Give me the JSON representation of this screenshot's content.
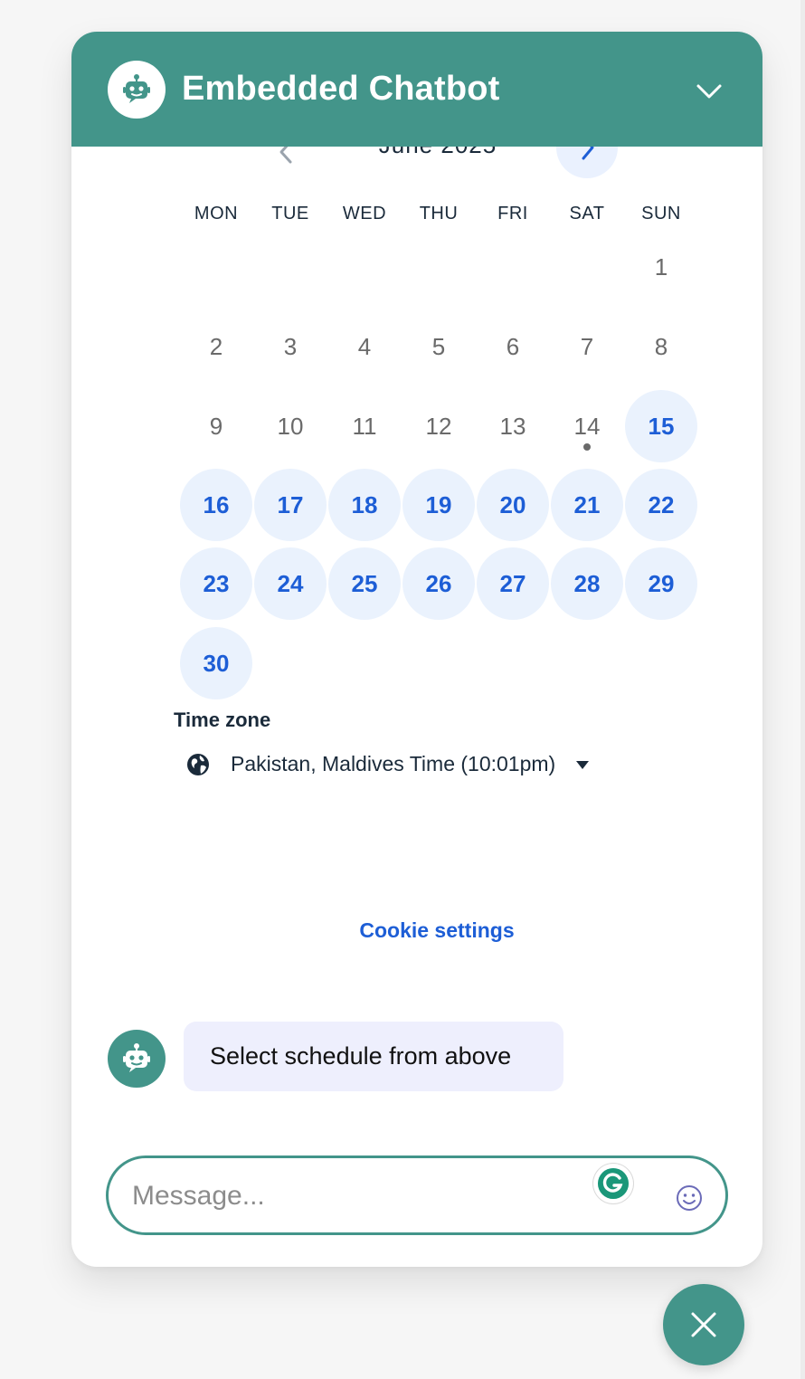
{
  "header": {
    "title": "Embedded Chatbot",
    "avatar_icon": "robot-icon",
    "collapse_icon": "chevron-down-icon"
  },
  "calendar": {
    "month_label": "June 2025",
    "weekdays": [
      "MON",
      "TUE",
      "WED",
      "THU",
      "FRI",
      "SAT",
      "SUN"
    ],
    "days": [
      {
        "n": "1",
        "available": false
      },
      {
        "n": "2",
        "available": false
      },
      {
        "n": "3",
        "available": false
      },
      {
        "n": "4",
        "available": false
      },
      {
        "n": "5",
        "available": false
      },
      {
        "n": "6",
        "available": false
      },
      {
        "n": "7",
        "available": false
      },
      {
        "n": "8",
        "available": false
      },
      {
        "n": "9",
        "available": false
      },
      {
        "n": "10",
        "available": false
      },
      {
        "n": "11",
        "available": false
      },
      {
        "n": "12",
        "available": false
      },
      {
        "n": "13",
        "available": false
      },
      {
        "n": "14",
        "available": false,
        "today": true
      },
      {
        "n": "15",
        "available": true
      },
      {
        "n": "16",
        "available": true
      },
      {
        "n": "17",
        "available": true
      },
      {
        "n": "18",
        "available": true
      },
      {
        "n": "19",
        "available": true
      },
      {
        "n": "20",
        "available": true
      },
      {
        "n": "21",
        "available": true
      },
      {
        "n": "22",
        "available": true
      },
      {
        "n": "23",
        "available": true
      },
      {
        "n": "24",
        "available": true
      },
      {
        "n": "25",
        "available": true
      },
      {
        "n": "26",
        "available": true
      },
      {
        "n": "27",
        "available": true
      },
      {
        "n": "28",
        "available": true
      },
      {
        "n": "29",
        "available": true
      },
      {
        "n": "30",
        "available": true
      }
    ],
    "timezone_heading": "Time zone",
    "timezone_value": "Pakistan, Maldives Time (10:01pm)",
    "cookie_link": "Cookie settings"
  },
  "chat": {
    "bot_message": "Select schedule from above"
  },
  "input": {
    "placeholder": "Message..."
  },
  "colors": {
    "brand": "#43958a",
    "available_text": "#1d5ed6",
    "available_bg": "#eaf2fd",
    "bubble_bg": "#eeeffd"
  }
}
